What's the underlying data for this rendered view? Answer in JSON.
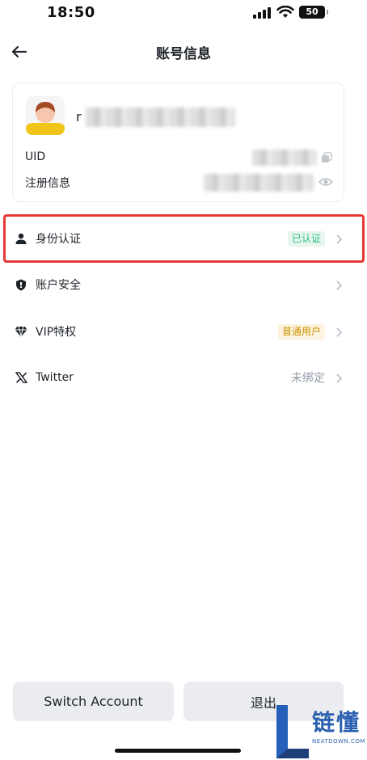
{
  "status_bar": {
    "time": "18:50",
    "battery": "50"
  },
  "header": {
    "title": "账号信息"
  },
  "profile": {
    "username_initial": "r",
    "uid_label": "UID",
    "reg_label": "注册信息"
  },
  "menu": {
    "identity": {
      "label": "身份认证",
      "badge": "已认证"
    },
    "security": {
      "label": "账户安全"
    },
    "vip": {
      "label": "VIP特权",
      "badge": "普通用户"
    },
    "twitter": {
      "label": "Twitter",
      "status": "未绑定"
    }
  },
  "buttons": {
    "switch_account": "Switch Account",
    "logout": "退出"
  },
  "watermark": {
    "cn": "链懂",
    "en": "NEATDOWN.COM"
  },
  "colors": {
    "green_badge": "#2ebd85",
    "yellow_badge": "#c99400",
    "highlight": "#e53935",
    "avatar_yellow": "#f0c419"
  }
}
